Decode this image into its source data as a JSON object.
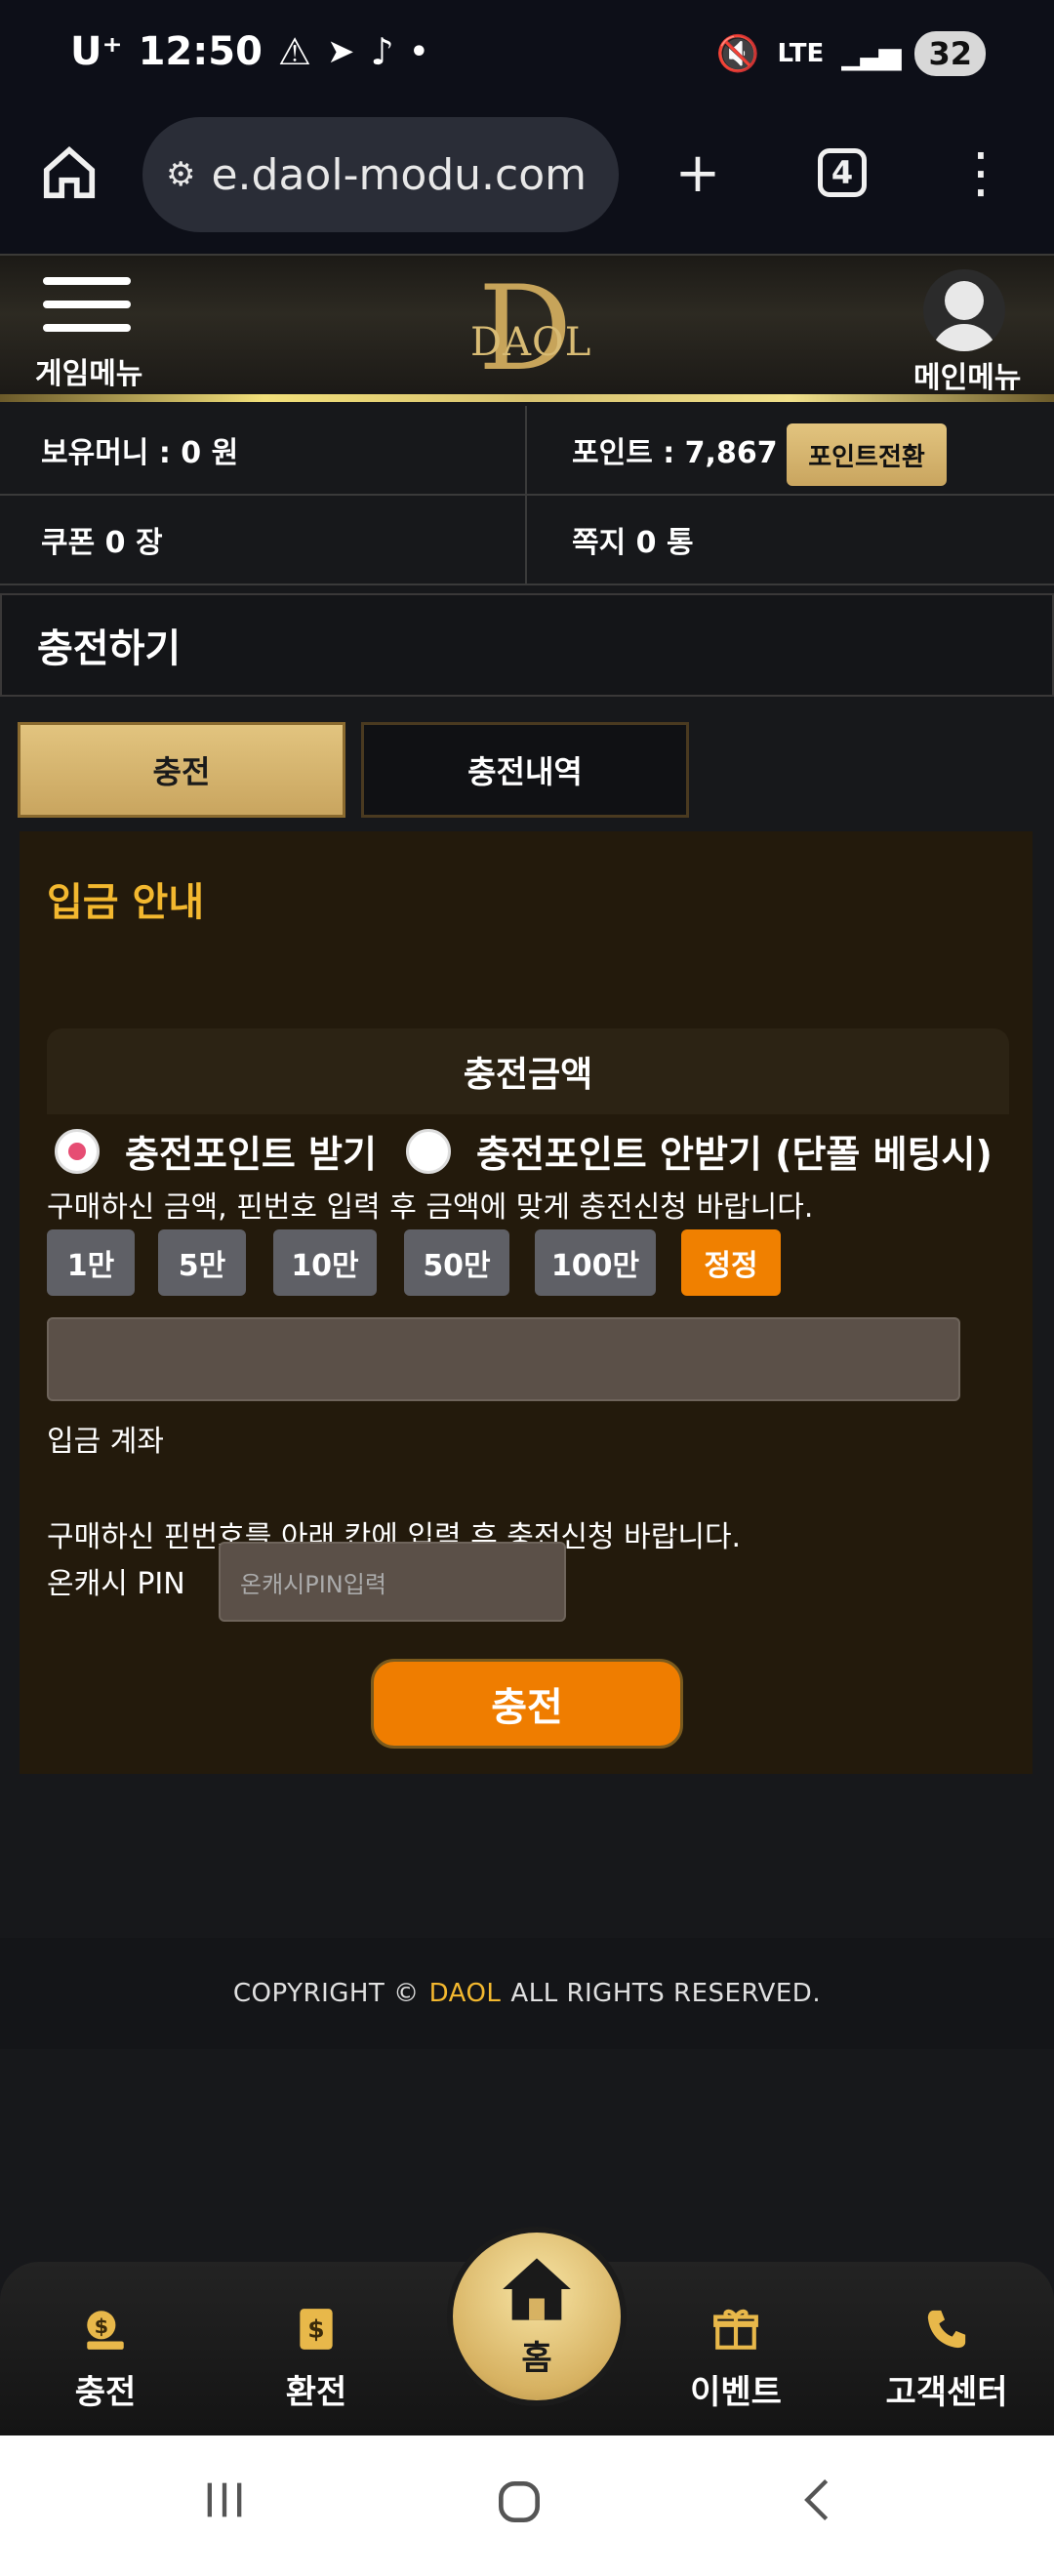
{
  "status_bar": {
    "carrier": "U⁺",
    "time": "12:50",
    "network": "LTE",
    "battery": "32"
  },
  "browser": {
    "url": "e.daol-modu.com",
    "tab_count": "4"
  },
  "header": {
    "left_label": "게임메뉴",
    "logo_text": "DAOL",
    "right_label": "메인메뉴"
  },
  "info": {
    "money": "보유머니 : 0 원",
    "points": "포인트 : 7,867 P",
    "point_convert_button": "포인트전환",
    "coupon": "쿠폰 0 장",
    "messages": "쪽지 0 통"
  },
  "section_title": "충전하기",
  "tabs": [
    {
      "label": "충전"
    },
    {
      "label": "충전내역"
    }
  ],
  "deposit": {
    "notice_title": "입금 안내",
    "amount_header": "충전금액",
    "radio_receive": "충전포인트 받기",
    "radio_no_receive": "충전포인트 안받기 (단폴 베팅시)",
    "amount_hint": "구매하신 금액, 핀번호 입력 후 금액에 맞게 충전신청 바랍니다.",
    "amount_buttons": [
      "1만",
      "5만",
      "10만",
      "50만",
      "100만"
    ],
    "reset_button": "정정",
    "account_label": "입금 계좌",
    "pin_hint": "구매하신 핀번호를 아래 칸에 입력 후 충전신청 바랍니다.",
    "pin_label": "온캐시 PIN",
    "pin_placeholder": "온캐시PIN입력",
    "submit_button": "충전"
  },
  "footer": {
    "prefix": "COPYRIGHT ©",
    "brand": "DAOL",
    "suffix": "ALL RIGHTS RESERVED."
  },
  "bottom_nav": {
    "charge": "충전",
    "exchange": "환전",
    "home": "홈",
    "event": "이벤트",
    "support": "고객센터"
  },
  "colors": {
    "gold": "#d7b262",
    "orange": "#ef7d00",
    "accent_yellow": "#f3b82f"
  }
}
